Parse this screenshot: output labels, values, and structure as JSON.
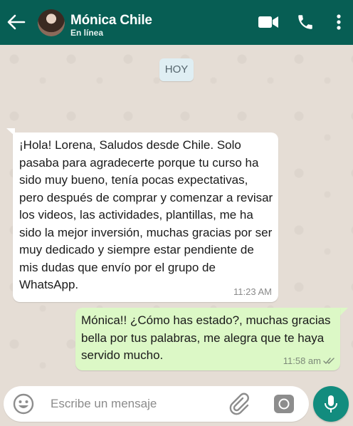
{
  "header": {
    "contact_name": "Mónica Chile",
    "status": "En línea",
    "icons": [
      "back-arrow-icon",
      "avatar",
      "video-call-icon",
      "phone-icon",
      "menu-dots-icon"
    ],
    "background_color": "#075e54"
  },
  "chat": {
    "day_label": "HOY",
    "messages": [
      {
        "direction": "incoming",
        "text": "¡Hola! Lorena, Saludos desde Chile. Solo pasaba para agradecerte porque tu curso ha sido muy bueno, tenía pocas expectativas, pero después de comprar y comenzar a revisar los videos, las actividades, plantillas, me ha sido la mejor inversión, muchas gracias por ser muy dedicado y siempre estar pendiente de mis dudas que envío por el grupo de WhatsApp.",
        "time": "11:23 AM",
        "bubble_color": "#ffffff"
      },
      {
        "direction": "outgoing",
        "text": "Mónica!! ¿Cómo has estado?, muchas gracias bella por tus palabras, me alegra que te haya servido mucho.",
        "time": "11:58 am",
        "status_icon": "double-check-icon",
        "bubble_color": "#dcf8c6"
      }
    ]
  },
  "input": {
    "placeholder": "Escribe un mensaje",
    "value": "",
    "icons": [
      "emoji-icon",
      "attach-icon",
      "camera-icon",
      "mic-icon"
    ],
    "mic_color": "#128c7e"
  }
}
